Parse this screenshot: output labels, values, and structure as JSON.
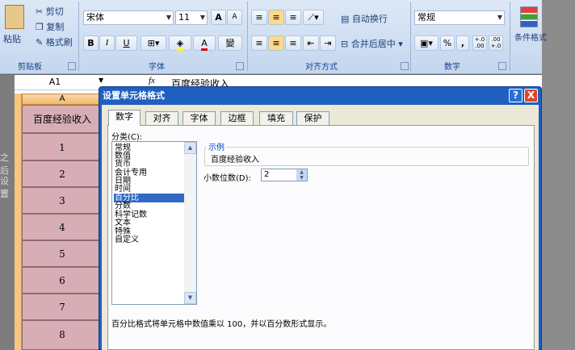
{
  "ribbon": {
    "clipboard": {
      "cut": "剪切",
      "copy": "复制",
      "format_painter": "格式刷",
      "paste": "粘贴",
      "label": "剪贴板"
    },
    "font": {
      "name": "宋体",
      "size": "11",
      "grow": "A",
      "shrink": "A",
      "bold": "B",
      "italic": "I",
      "underline": "U",
      "font_color_letter": "A",
      "wen": "變",
      "label": "字体"
    },
    "alignment": {
      "wrap_text": "自动换行",
      "merge_center": "合并后居中",
      "label": "对齐方式"
    },
    "number": {
      "format": "常规",
      "percent": "%",
      "comma": ",",
      "inc_decimal": "+.0 .00",
      "dec_decimal": ".00 +.0",
      "label": "数字"
    },
    "styles": {
      "conditional_format": "条件格式"
    }
  },
  "formula_bar": {
    "name_box": "A1",
    "fx": "fx",
    "content": "百度经验收入"
  },
  "sheet": {
    "column_letter": "A",
    "header_cell": "百度经验收入",
    "rows": [
      "1",
      "2",
      "3",
      "4",
      "5",
      "6",
      "7",
      "8"
    ],
    "left_fragments": [
      "之后",
      "设置"
    ]
  },
  "dialog": {
    "title": "设置单元格格式",
    "help": "?",
    "close": "X",
    "tabs": [
      "数字",
      "对齐",
      "字体",
      "边框",
      "填充",
      "保护"
    ],
    "active_tab": "数字",
    "category_label": "分类(C):",
    "categories": [
      "常规",
      "数值",
      "货币",
      "会计专用",
      "日期",
      "时间",
      "百分比",
      "分数",
      "科学记数",
      "文本",
      "特殊",
      "自定义"
    ],
    "selected_category": "百分比",
    "sample_label": "示例",
    "sample_value": "百度经验收入",
    "decimal_label": "小数位数(D):",
    "decimal_value": "2",
    "description": "百分比格式将单元格中数值乘以 100，并以百分数形式显示。"
  },
  "colors": {
    "accent": "#1f5fc2",
    "selection": "#316ac5",
    "cell_fill": "#d7aeb6",
    "header_orange": "#f6c77f"
  }
}
